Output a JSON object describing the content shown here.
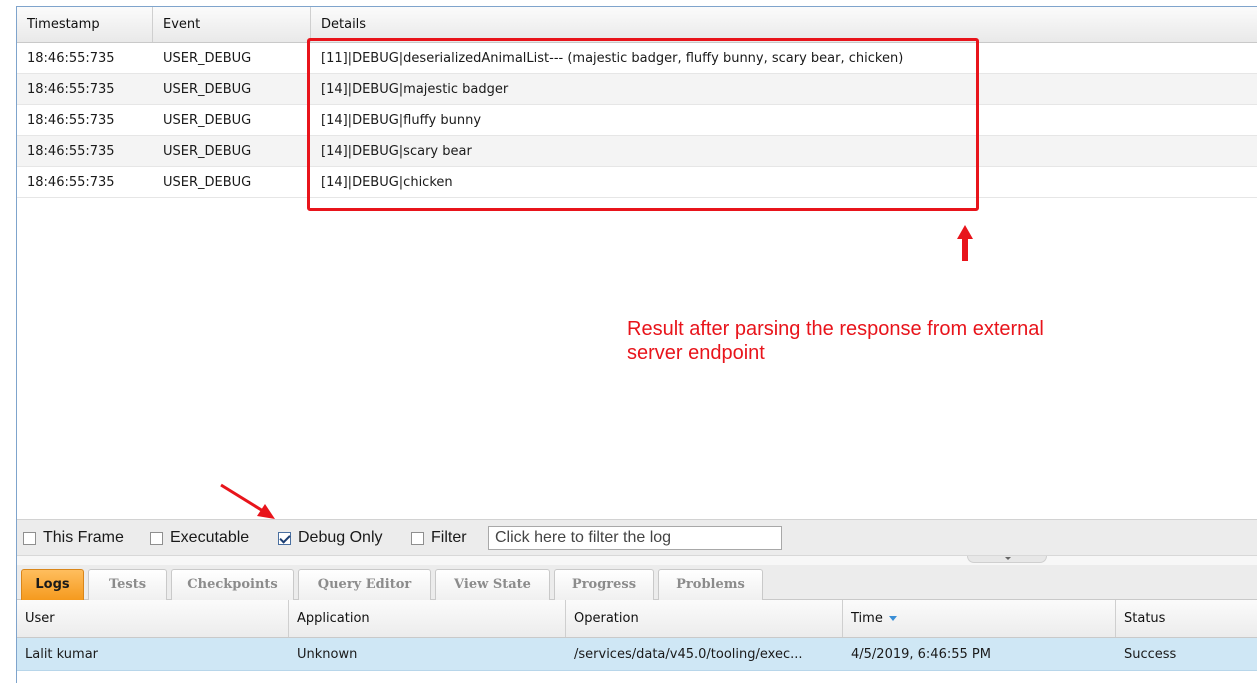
{
  "log": {
    "columns": [
      "Timestamp",
      "Event",
      "Details"
    ],
    "rows": [
      {
        "timestamp": "18:46:55:735",
        "event": "USER_DEBUG",
        "details": "[11]|DEBUG|deserializedAnimalList--- (majestic badger, fluffy bunny, scary bear, chicken)"
      },
      {
        "timestamp": "18:46:55:735",
        "event": "USER_DEBUG",
        "details": "[14]|DEBUG|majestic badger"
      },
      {
        "timestamp": "18:46:55:735",
        "event": "USER_DEBUG",
        "details": "[14]|DEBUG|fluffy bunny"
      },
      {
        "timestamp": "18:46:55:735",
        "event": "USER_DEBUG",
        "details": "[14]|DEBUG|scary bear"
      },
      {
        "timestamp": "18:46:55:735",
        "event": "USER_DEBUG",
        "details": "[14]|DEBUG|chicken"
      }
    ]
  },
  "annotation": {
    "text": "Result after parsing the response from external server endpoint",
    "color": "#e8141b"
  },
  "filter_bar": {
    "this_frame": {
      "label": "This Frame",
      "checked": false
    },
    "executable": {
      "label": "Executable",
      "checked": false
    },
    "debug_only": {
      "label": "Debug Only",
      "checked": true
    },
    "filter": {
      "label": "Filter",
      "checked": false
    },
    "filter_placeholder": "Click here to filter the log"
  },
  "tabs": [
    {
      "label": "Logs",
      "active": true
    },
    {
      "label": "Tests",
      "active": false
    },
    {
      "label": "Checkpoints",
      "active": false
    },
    {
      "label": "Query Editor",
      "active": false
    },
    {
      "label": "View State",
      "active": false
    },
    {
      "label": "Progress",
      "active": false
    },
    {
      "label": "Problems",
      "active": false
    }
  ],
  "logs_table": {
    "columns": [
      "User",
      "Application",
      "Operation",
      "Time",
      "Status"
    ],
    "sort_column": "Time",
    "rows": [
      {
        "user": "Lalit kumar",
        "application": "Unknown",
        "operation": "/services/data/v45.0/tooling/exec...",
        "time": "4/5/2019, 6:46:55 PM",
        "status": "Success"
      }
    ]
  },
  "colors": {
    "active_tab": "#f59a1e",
    "selected_row": "#cfe7f5",
    "frame_border": "#7fa4cc"
  }
}
